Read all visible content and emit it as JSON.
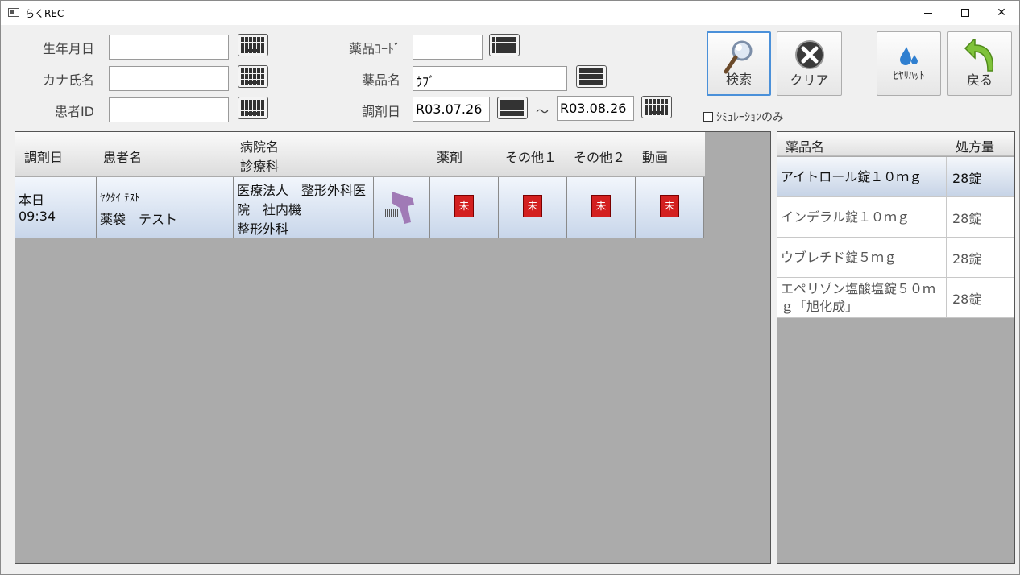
{
  "window": {
    "title": "らくREC"
  },
  "search": {
    "birthdate_label": "生年月日",
    "kana_label": "カナ氏名",
    "patient_id_label": "患者ID",
    "drug_code_label": "薬品ｺｰﾄﾞ",
    "drug_name_label": "薬品名",
    "drug_name_value": "ｳﾌﾞ",
    "dispense_date_label": "調剤日",
    "date_from": "R03.07.26",
    "date_sep": "～",
    "date_to": "R03.08.26",
    "simulation_label": "ｼﾐｭﾚｰｼｮﾝのみ"
  },
  "buttons": {
    "search": "検索",
    "clear": "クリア",
    "hiyari": "ﾋﾔﾘﾊｯﾄ",
    "back": "戻る"
  },
  "grid": {
    "headers": {
      "date": "調剤日",
      "patient": "患者名",
      "hospital_line1": "病院名",
      "hospital_line2": "診療科",
      "drug": "薬剤",
      "other1": "その他１",
      "other2": "その他２",
      "video": "動画"
    },
    "rows": [
      {
        "date_line1": "本日",
        "date_line2": "09:34",
        "patient_kana": "ﾔｸﾀｲ ﾃｽﾄ",
        "patient_name": "薬袋　テスト",
        "hospital_line1": "医療法人　整形外科医",
        "hospital_line2": "院　社内機",
        "department": "整形外科",
        "status_drug": "未",
        "status_other1": "未",
        "status_other2": "未",
        "status_video": "未"
      }
    ]
  },
  "drugs": {
    "headers": {
      "name": "薬品名",
      "quantity": "処方量"
    },
    "items": [
      {
        "name": "アイトロール錠１０ｍｇ",
        "quantity": "28錠"
      },
      {
        "name": "インデラル錠１０ｍｇ",
        "quantity": "28錠"
      },
      {
        "name": "ウブレチド錠５ｍｇ",
        "quantity": "28錠"
      },
      {
        "name": "エペリゾン塩酸塩錠５０ｍｇ「旭化成」",
        "quantity": "28錠"
      }
    ]
  },
  "colors": {
    "accent": "#4a90d9",
    "status": "#d32020",
    "grid_bg": "#ababab"
  }
}
